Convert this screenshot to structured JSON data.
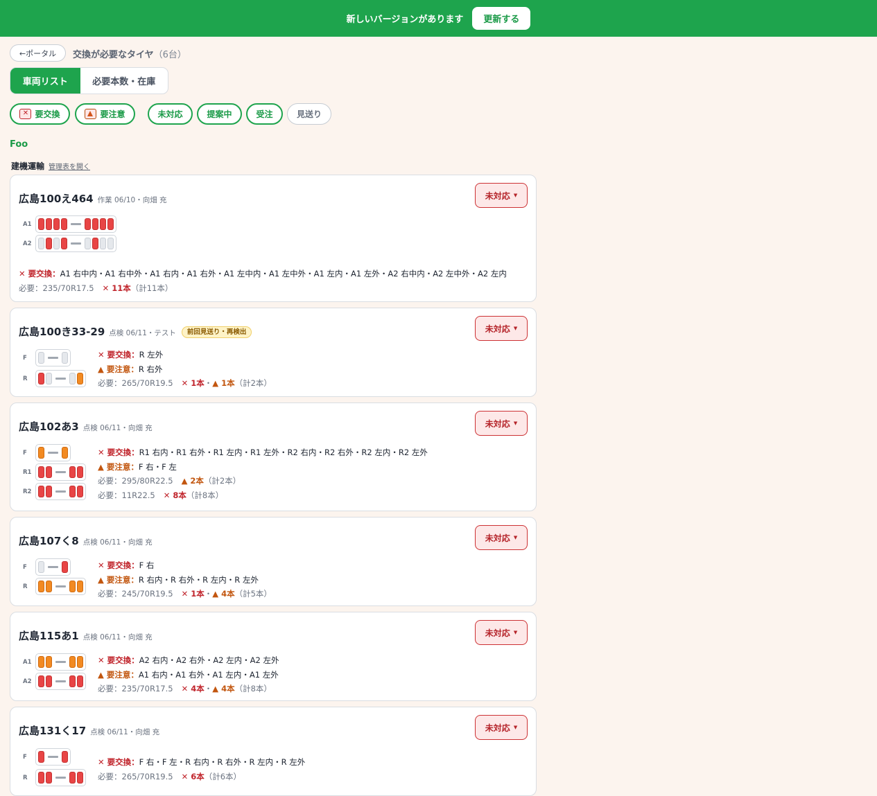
{
  "banner": {
    "message": "新しいバージョンがあります",
    "button": "更新する"
  },
  "nav": {
    "back": "←ポータル",
    "title": "交換が必要なタイヤ",
    "count": "（6台）"
  },
  "tabs": [
    "車両リスト",
    "必要本数・在庫"
  ],
  "filters": {
    "replace": "要交換",
    "caution": "要注意",
    "status": [
      "未対応",
      "提案中",
      "受注",
      "見送り"
    ]
  },
  "group": "Foo",
  "company": {
    "name": "建機運輸",
    "link": "管理表を開く"
  },
  "labels": {
    "replace": "要交換：",
    "caution": "要注意：",
    "sep": "・"
  },
  "vehicles": [
    {
      "plate": "広島100え464",
      "meta": "作業 06/10・向畑 充",
      "status": "未対応",
      "axles": [
        {
          "name": "A1",
          "left": [
            "x",
            "x",
            "x",
            "x"
          ],
          "right": [
            "x",
            "x",
            "x",
            "x"
          ]
        },
        {
          "name": "A2",
          "left": [
            "n",
            "x",
            "n",
            "x"
          ],
          "right": [
            "n",
            "x",
            "n",
            "n"
          ]
        }
      ],
      "replace": "A1 右中内・A1 右中外・A1 右内・A1 右外・A1 左中内・A1 左中外・A1 左内・A1 左外・A2 右中内・A2 左中外・A2 左内",
      "needs": [
        {
          "spec": "必要：235/70R17.5",
          "x": "11本",
          "w": "",
          "total": "（計11本）"
        }
      ]
    },
    {
      "plate": "広島100き33-29",
      "meta": "点検 06/11・テスト",
      "tag": "前回見送り・再検出",
      "status": "未対応",
      "axles": [
        {
          "name": "F",
          "left": [
            "n"
          ],
          "right": [
            "n"
          ]
        },
        {
          "name": "R",
          "left": [
            "x",
            "n"
          ],
          "right": [
            "n",
            "w"
          ]
        }
      ],
      "replace": "R 左外",
      "caution": "R 右外",
      "needs": [
        {
          "spec": "必要：265/70R19.5",
          "x": "1本",
          "w": "1本",
          "total": "（計2本）"
        }
      ]
    },
    {
      "plate": "広島102あ3",
      "meta": "点検 06/11・向畑 充",
      "status": "未対応",
      "axles": [
        {
          "name": "F",
          "left": [
            "w"
          ],
          "right": [
            "w"
          ]
        },
        {
          "name": "R1",
          "left": [
            "x",
            "x"
          ],
          "right": [
            "x",
            "x"
          ]
        },
        {
          "name": "R2",
          "left": [
            "x",
            "x"
          ],
          "right": [
            "x",
            "x"
          ]
        }
      ],
      "replace": "R1 右内・R1 右外・R1 左内・R1 左外・R2 右内・R2 右外・R2 左内・R2 左外",
      "caution": "F 右・F 左",
      "needs": [
        {
          "spec": "必要：295/80R22.5",
          "x": "",
          "w": "2本",
          "total": "（計2本）"
        },
        {
          "spec": "必要：11R22.5",
          "x": "8本",
          "w": "",
          "total": "（計8本）"
        }
      ]
    },
    {
      "plate": "広島107く8",
      "meta": "点検 06/11・向畑 充",
      "status": "未対応",
      "axles": [
        {
          "name": "F",
          "left": [
            "n"
          ],
          "right": [
            "x"
          ]
        },
        {
          "name": "R",
          "left": [
            "w",
            "w"
          ],
          "right": [
            "w",
            "w"
          ]
        }
      ],
      "replace": "F 右",
      "caution": "R 右内・R 右外・R 左内・R 左外",
      "needs": [
        {
          "spec": "必要：245/70R19.5",
          "x": "1本",
          "w": "4本",
          "total": "（計5本）"
        }
      ]
    },
    {
      "plate": "広島115あ1",
      "meta": "点検 06/11・向畑 充",
      "status": "未対応",
      "axles": [
        {
          "name": "A1",
          "left": [
            "w",
            "w"
          ],
          "right": [
            "w",
            "w"
          ]
        },
        {
          "name": "A2",
          "left": [
            "x",
            "x"
          ],
          "right": [
            "x",
            "x"
          ]
        }
      ],
      "replace": "A2 右内・A2 右外・A2 左内・A2 左外",
      "caution": "A1 右内・A1 右外・A1 左内・A1 左外",
      "needs": [
        {
          "spec": "必要：235/70R17.5",
          "x": "4本",
          "w": "4本",
          "total": "（計8本）"
        }
      ]
    },
    {
      "plate": "広島131く17",
      "meta": "点検 06/11・向畑 充",
      "status": "未対応",
      "axles": [
        {
          "name": "F",
          "left": [
            "x"
          ],
          "right": [
            "x"
          ]
        },
        {
          "name": "R",
          "left": [
            "x",
            "x"
          ],
          "right": [
            "x",
            "x"
          ]
        }
      ],
      "replace": "F 右・F 左・R 右内・R 右外・R 左内・R 左外",
      "needs": [
        {
          "spec": "必要：265/70R19.5",
          "x": "6本",
          "w": "",
          "total": "（計6本）"
        }
      ]
    }
  ]
}
